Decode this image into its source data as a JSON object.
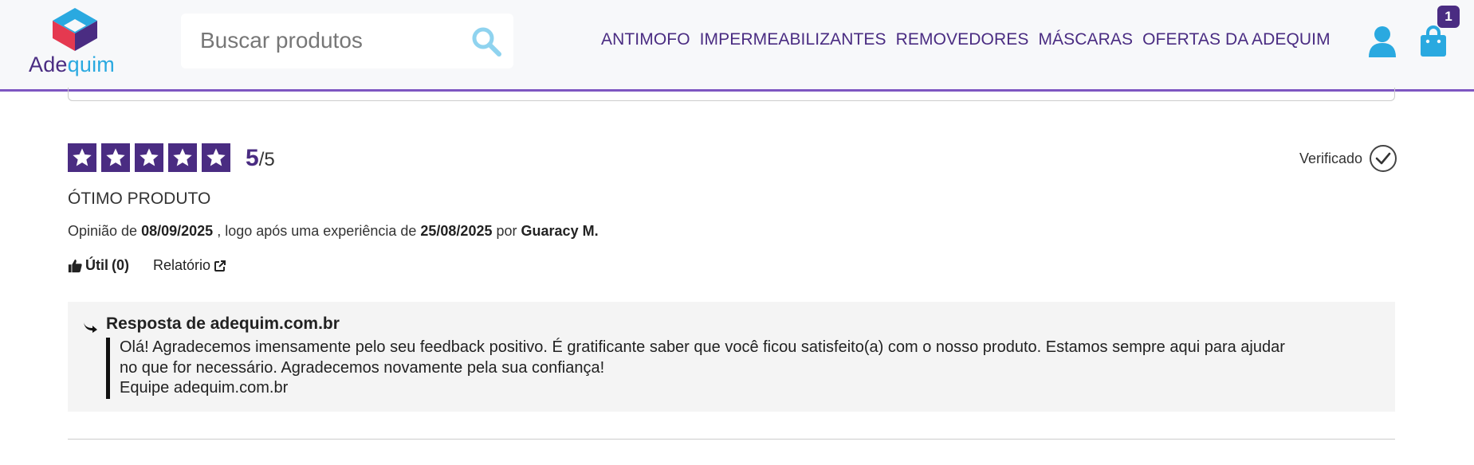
{
  "header": {
    "logo": {
      "part1": "Ade",
      "part2": "quim"
    },
    "search": {
      "placeholder": "Buscar produtos"
    },
    "nav": [
      "ANTIMOFO",
      "IMPERMEABILIZANTES",
      "REMOVEDORES",
      "MÁSCARAS",
      "OFERTAS DA ADEQUIM"
    ],
    "cart": {
      "count": "1"
    },
    "colors": {
      "brand": "#4a2c82",
      "accent": "#2aa9e0",
      "underline": "#7e57c2"
    }
  },
  "review": {
    "stars": 5,
    "rating": "5",
    "rating_out_of": "/5",
    "verified_label": "Verificado",
    "title": "ÓTIMO PRODUTO",
    "meta": {
      "prefix": "Opinião de",
      "review_date": "08/09/2025",
      "middle": ", logo após uma experiência de",
      "experience_date": "25/08/2025",
      "by": "por",
      "author": "Guaracy M."
    },
    "useful_label": "Útil",
    "useful_count": "(0)",
    "report_label": "Relatório"
  },
  "reply": {
    "title": "Resposta de adequim.com.br",
    "line1": "Olá! Agradecemos imensamente pelo seu feedback positivo. É gratificante saber que você ficou satisfeito(a) com o nosso produto. Estamos sempre aqui para ajudar",
    "line2": "no que for necessário. Agradecemos novamente pela sua confiança!",
    "line3": "Equipe adequim.com.br"
  }
}
